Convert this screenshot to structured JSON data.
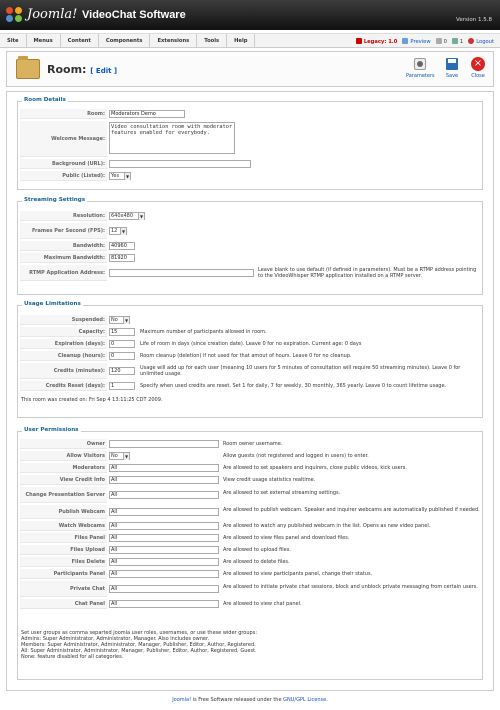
{
  "header": {
    "brand": "Joomla!",
    "app_title": "VideoChat Software",
    "version": "Version 1.5.8"
  },
  "menu": [
    "Site",
    "Menus",
    "Content",
    "Components",
    "Extensions",
    "Tools",
    "Help"
  ],
  "status": {
    "legacy": "Legacy: 1.0",
    "preview": "Preview",
    "messages": "0",
    "users": "1",
    "logout": "Logout"
  },
  "toolbar": {
    "title": "Room:",
    "edit": "[ Edit ]",
    "parameters": "Parameters",
    "save": "Save",
    "close": "Close"
  },
  "room_details": {
    "legend": "Room Details",
    "room_label": "Room:",
    "room_value": "Moderators Demo",
    "welcome_label": "Welcome Message:",
    "welcome_value": "Video consultation room with moderator features enabled for everybody.",
    "background_label": "Background (URL):",
    "background_value": "",
    "public_label": "Public (Listed):",
    "public_value": "Yes"
  },
  "streaming": {
    "legend": "Streaming Settings",
    "resolution_label": "Resolution:",
    "resolution_value": "640x480",
    "fps_label": "Frames Per Second (FPS):",
    "fps_value": "12",
    "bandwidth_label": "Bandwidth:",
    "bandwidth_value": "40960",
    "maxbw_label": "Maximum Bandwidth:",
    "maxbw_value": "81920",
    "rtmp_label": "RTMP Application Address:",
    "rtmp_value": "",
    "rtmp_note": "Leave blank to use default (if defined in parameters). Must be a RTMP address pointing to the VideoWhisper RTMP application installed on a RTMP server."
  },
  "usage": {
    "legend": "Usage Limitations",
    "suspended_label": "Suspended:",
    "suspended_value": "No",
    "capacity_label": "Capacity:",
    "capacity_value": "15",
    "capacity_note": "Maximum number of participants allowed in room.",
    "expiration_label": "Expiration (days):",
    "expiration_value": "0",
    "expiration_note": "Life of room in days (since creation date). Leave 0 for no expiration. Current age: 0 days",
    "cleanup_label": "Cleanup (hours):",
    "cleanup_value": "0",
    "cleanup_note": "Room cleanup (deletion) if not used for that amout of hours. Leave 0 for no cleanup.",
    "credits_label": "Credits (minutes):",
    "credits_value": "120",
    "credits_note": "Usage will add up for each user (meaning 10 users for 5 minutes of consultation will require 50 streaming minutes). Leave 0 for unlimited usage.",
    "reset_label": "Credits Reset (days):",
    "reset_value": "1",
    "reset_note": "Specify when used credits are reset. Set 1 for daily, 7 for weekly, 30 monthly, 365 yearly. Leave 0 to count lifetime usage.",
    "created": "This room was created on: Fri Sep 4 13:11:25 CDT 2009."
  },
  "permissions": {
    "legend": "User Permissions",
    "rows": [
      {
        "label": "Owner",
        "value": "",
        "type": "input",
        "note": "Room owner username."
      },
      {
        "label": "Allow Visitors",
        "value": "No",
        "type": "select",
        "note": "Allow guests (not registered and logged in users) to enter."
      },
      {
        "label": "Moderators",
        "value": "All",
        "type": "input",
        "note": "Are allowed to set speakers and inquirers, close public videos, kick users."
      },
      {
        "label": "View Credit Info",
        "value": "All",
        "type": "input",
        "note": "View credit usage statistics realtime."
      },
      {
        "label": "Change Presentation Server",
        "value": "All",
        "type": "input",
        "note": "Are allowed to set external streaming settings."
      },
      {
        "label": "Publish Webcam",
        "value": "All",
        "type": "input",
        "note": "Are allowed to publish webcam. Speaker and inquirer webcams are automatically published if needed."
      },
      {
        "label": "Watch Webcams",
        "value": "All",
        "type": "input",
        "note": "Are allowed to watch any published webcam in the list. Opens as new video panel."
      },
      {
        "label": "Files Panel",
        "value": "All",
        "type": "input",
        "note": "Are allowed to view files panel and download files."
      },
      {
        "label": "Files Upload",
        "value": "All",
        "type": "input",
        "note": "Are allowed to upload files."
      },
      {
        "label": "Files Delete",
        "value": "All",
        "type": "input",
        "note": "Are allowed to delete files."
      },
      {
        "label": "Participants Panel",
        "value": "All",
        "type": "input",
        "note": "Are allowed to view participants panel, change their status."
      },
      {
        "label": "Private Chat",
        "value": "All",
        "type": "input",
        "note": "Are allowed to initiate private chat sessions, block and unblock private messaging from certain users."
      },
      {
        "label": "Chat Panel",
        "value": "All",
        "type": "input",
        "note": "Are allowed to view chat panel."
      }
    ],
    "help": "Set user groups as comma separted joomla user roles, usernames, or use these wider groups:\nAdmins: Super Administrator, Administrator, Manager. Also includes owner.\nMembers: Super Administrator, Administrator, Manager, Publisher, Editor, Author, Registered.\nAll: Super Administrator, Administrator, Manager, Publisher, Editor, Author, Registered, Guest.\nNone: feature disabled for all categories."
  },
  "footer": {
    "link": "Joomla!",
    "text": " is Free Software released under the ",
    "license": "GNU/GPL License."
  }
}
